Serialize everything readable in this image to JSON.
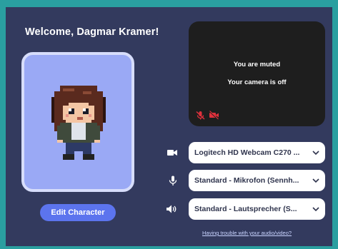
{
  "welcome": {
    "text": "Welcome, Dagmar Kramer!"
  },
  "avatar": {
    "edit_label": "Edit Character"
  },
  "preview": {
    "muted_text": "You are muted",
    "camera_text": "Your camera is off"
  },
  "devices": {
    "camera": "Logitech HD Webcam C270 ...",
    "microphone": "Standard - Mikrofon (Sennh...",
    "speaker": "Standard - Lautsprecher (S..."
  },
  "help": {
    "link_text": "Having trouble with your audio/video?"
  },
  "colors": {
    "frame": "#2a9fa0",
    "panel": "#333a5e",
    "accent": "#5c74ee",
    "muted_icon": "#e0313c"
  },
  "icons": {
    "camera": "video-camera-icon",
    "microphone": "microphone-icon",
    "speaker": "speaker-icon",
    "dropdown": "chevron-down-icon",
    "muted_mic": "microphone-muted-icon",
    "camera_off": "camera-off-icon"
  }
}
